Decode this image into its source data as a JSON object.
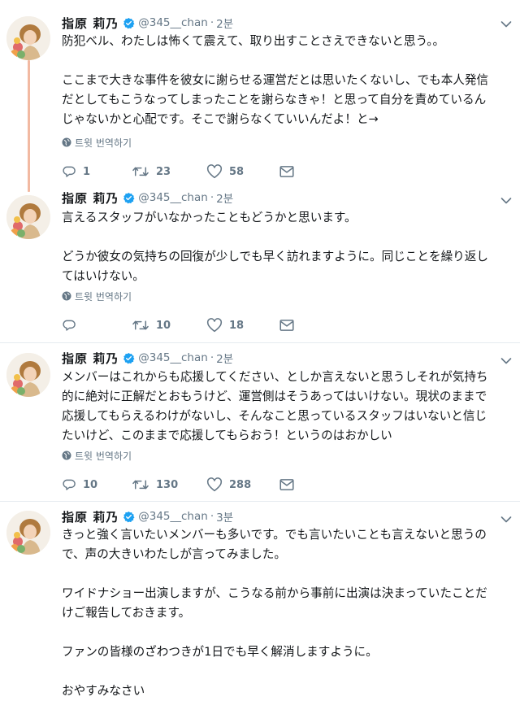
{
  "tweets": [
    {
      "display_name": "指原 莉乃",
      "handle": "@345__chan",
      "separator": "·",
      "time": "2분",
      "lines": [
        "防犯ベル、わたしは怖くて震えて、取り出すことさえできないと思う。。",
        "",
        "ここまで大きな事件を彼女に謝らせる運営だとは思いたくないし、でも本人発信",
        "だとしてもこうなってしまったことを謝らなきゃ！と思って自分を責めているん",
        "じゃないかと心配です。そこで謝らなくていいんだよ！と→"
      ],
      "translate_label": "트윗 번역하기",
      "reply_count": "1",
      "retweet_count": "23",
      "like_count": "58"
    },
    {
      "display_name": "指原 莉乃",
      "handle": "@345__chan",
      "separator": "·",
      "time": "2분",
      "lines": [
        "言えるスタッフがいなかったこともどうかと思います。",
        "",
        "どうか彼女の気持ちの回復が少しでも早く訪れますように。同じことを繰り返し",
        "てはいけない。"
      ],
      "translate_label": "트윗 번역하기",
      "reply_count": "",
      "retweet_count": "10",
      "like_count": "18"
    },
    {
      "display_name": "指原 莉乃",
      "handle": "@345__chan",
      "separator": "·",
      "time": "2분",
      "lines": [
        "メンバーはこれからも応援してください、としか言えないと思うしそれが気持ち",
        "的に絶対に正解だとおもうけど、運営側はそうあってはいけない。現状のままで",
        "応援してもらえるわけがないし、そんなこと思っているスタッフはいないと信じ",
        "たいけど、このままで応援してもらおう！というのはおかしい"
      ],
      "translate_label": "트윗 번역하기",
      "reply_count": "10",
      "retweet_count": "130",
      "like_count": "288"
    },
    {
      "display_name": "指原 莉乃",
      "handle": "@345__chan",
      "separator": "·",
      "time": "3분",
      "lines": [
        "きっと強く言いたいメンバーも多いです。でも言いたいことも言えないと思うの",
        "で、声の大きいわたしが言ってみました。",
        "",
        "ワイドナショー出演しますが、こうなる前から事前に出演は決まっていたことだ",
        "けご報告しておきます。",
        "",
        "ファンの皆様のざわつきが1日でも早く解消しますように。",
        "",
        "おやすみなさい"
      ],
      "translate_label": "",
      "reply_count": "",
      "retweet_count": "",
      "like_count": ""
    }
  ],
  "colors": {
    "verified": "#1da1f2",
    "muted_text": "#657786",
    "thread_line": "#f2b9a2",
    "separator": "#e6ecf0"
  },
  "icons": {
    "reply": "reply-icon",
    "retweet": "retweet-icon",
    "like": "heart-icon",
    "dm": "envelope-icon",
    "translate": "globe-icon",
    "verified": "verified-badge-icon",
    "caret": "chevron-down-icon"
  }
}
